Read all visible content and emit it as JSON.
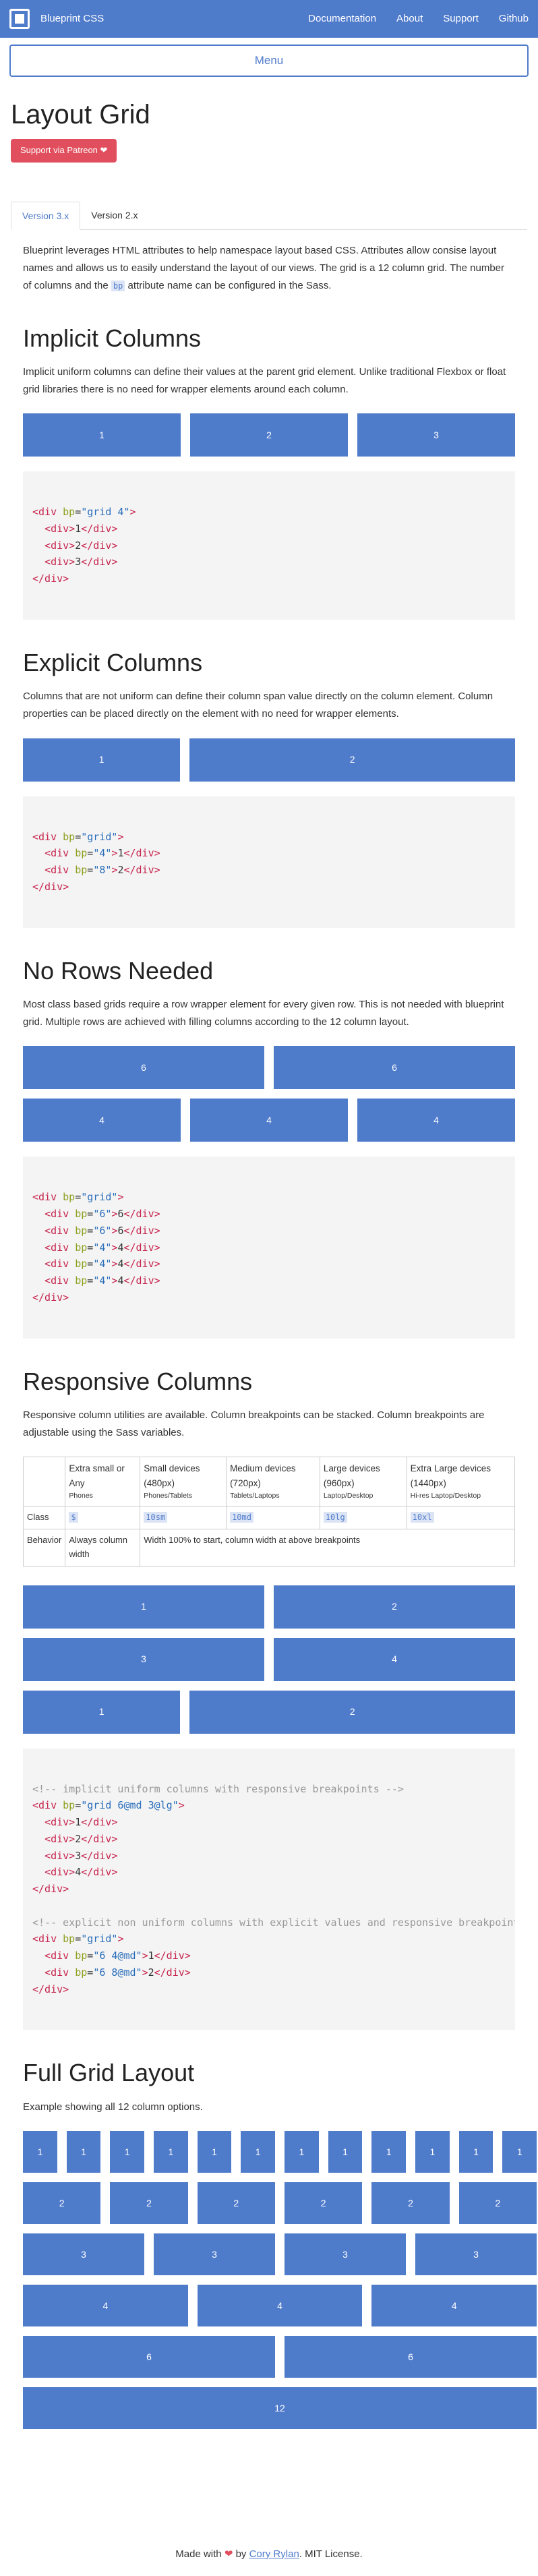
{
  "nav": {
    "brand": "Blueprint CSS",
    "links": [
      "Documentation",
      "About",
      "Support",
      "Github"
    ],
    "menu_label": "Menu"
  },
  "title": "Layout Grid",
  "patreon_label": "Support via Patreon",
  "tabs": [
    "Version 3.x",
    "Version 2.x"
  ],
  "intro": {
    "before": "Blueprint leverages HTML attributes to help namespace layout based CSS. Attributes allow consise layout names and allows us to easily understand the layout of our views. The grid is a 12 column grid. The number of columns and the ",
    "code": "bp",
    "after": " attribute name can be configured in the Sass."
  },
  "implicit": {
    "title": "Implicit Columns",
    "desc": "Implicit uniform columns can define their values at the parent grid element. Unlike traditional Flexbox or float grid libraries there is no need for wrapper elements around each column.",
    "cells": [
      "1",
      "2",
      "3"
    ]
  },
  "explicit": {
    "title": "Explicit Columns",
    "desc": "Columns that are not uniform can define their column span value directly on the column element. Column properties can be placed directly on the element with no need for wrapper elements.",
    "cells": [
      "1",
      "2"
    ]
  },
  "norows": {
    "title": "No Rows Needed",
    "desc": "Most class based grids require a row wrapper element for every given row. This is not needed with blueprint grid. Multiple rows are achieved with filling columns according to the 12 column layout.",
    "row1": [
      "6",
      "6"
    ],
    "row2": [
      "4",
      "4",
      "4"
    ]
  },
  "responsive": {
    "title": "Responsive Columns",
    "desc": "Responsive column utilities are available. Column breakpoints can be stacked. Column breakpoints are adjustable using the Sass variables.",
    "headers": [
      {
        "title": "Extra small or Any",
        "sub": "Phones"
      },
      {
        "title": "Small devices (480px)",
        "sub": "Phones/Tablets"
      },
      {
        "title": "Medium devices (720px)",
        "sub": "Tablets/Laptops"
      },
      {
        "title": "Large devices (960px)",
        "sub": "Laptop/Desktop"
      },
      {
        "title": "Extra Large devices (1440px)",
        "sub": "Hi-res Laptop/Desktop"
      }
    ],
    "class_label": "Class",
    "classes": [
      "$",
      "10sm",
      "10md",
      "10lg",
      "10xl"
    ],
    "behavior_label": "Behavior",
    "behavior_first": "Always column width",
    "behavior_rest": "Width 100% to start, column width at above breakpoints",
    "row1": [
      "1",
      "2"
    ],
    "row2": [
      "3",
      "4"
    ],
    "row3": [
      "1",
      "2"
    ]
  },
  "fullgrid": {
    "title": "Full Grid Layout",
    "desc": "Example showing all 12 column options.",
    "rows": [
      [
        "1",
        "1",
        "1",
        "1",
        "1",
        "1",
        "1",
        "1",
        "1",
        "1",
        "1",
        "1"
      ],
      [
        "2",
        "2",
        "2",
        "2",
        "2",
        "2"
      ],
      [
        "3",
        "3",
        "3",
        "3"
      ],
      [
        "4",
        "4",
        "4"
      ],
      [
        "6",
        "6"
      ],
      [
        "12"
      ]
    ]
  },
  "footer": {
    "before": "Made with",
    "by": "by",
    "author": "Cory Rylan",
    "after": ". MIT License."
  }
}
